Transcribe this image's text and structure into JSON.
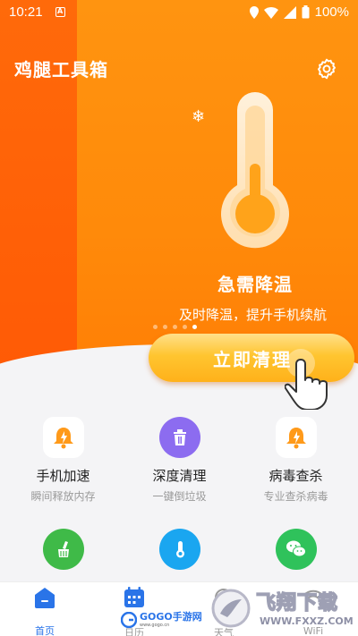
{
  "status_bar": {
    "time": "10:21",
    "battery": "100%"
  },
  "app": {
    "title": "鸡腿工具箱"
  },
  "hero": {
    "title": "急需降温",
    "subtitle": "及时降温，提升手机续航",
    "carousel_dots": 5,
    "carousel_active": 5,
    "cta": "立即清理"
  },
  "tools": [
    {
      "name": "手机加速",
      "desc": "瞬间释放内存",
      "icon": "rocket-bell-icon"
    },
    {
      "name": "深度清理",
      "desc": "一键倒垃圾",
      "icon": "trash-icon"
    },
    {
      "name": "病毒查杀",
      "desc": "专业查杀病毒",
      "icon": "shield-bell-icon"
    },
    {
      "name": "",
      "desc": "",
      "icon": "broom-icon"
    },
    {
      "name": "",
      "desc": "",
      "icon": "thermometer-icon"
    },
    {
      "name": "",
      "desc": "",
      "icon": "wechat-icon"
    }
  ],
  "nav": [
    {
      "label": "首页",
      "icon": "home-icon",
      "active": true
    },
    {
      "label": "日历",
      "icon": "calendar-icon",
      "active": false
    },
    {
      "label": "天气",
      "icon": "weather-icon",
      "active": false
    },
    {
      "label": "WiFi",
      "icon": "wifi-icon",
      "active": false
    }
  ],
  "watermarks": {
    "left": "GOGO手游网",
    "left_url": "www.gogo.cn",
    "right": "飞翔下载",
    "right_url": "WWW.FXXZ.COM"
  },
  "colors": {
    "hero_orange": "#ff8a0a",
    "hero_deep": "#ff5a05",
    "cta_yellow": "#ffc530",
    "accent_blue": "#2a74e8"
  }
}
